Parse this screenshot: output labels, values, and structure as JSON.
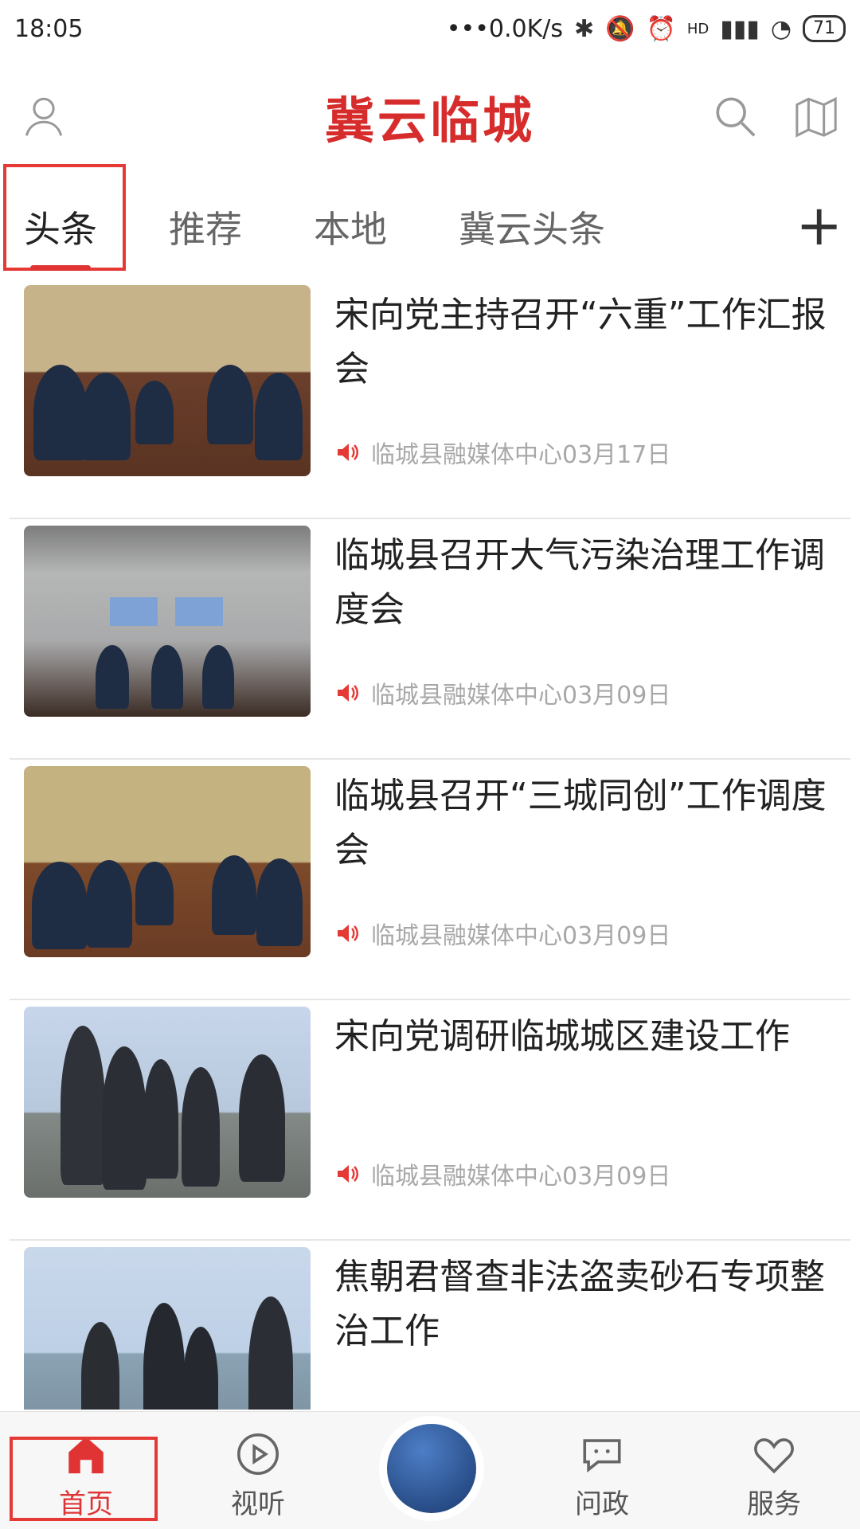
{
  "status_bar": {
    "time": "18:05",
    "network_speed": "•••0.0K/s",
    "signal_label": "HD",
    "battery": "71"
  },
  "header": {
    "title": "冀云临城",
    "left_icon": "user-icon",
    "right_icons": [
      "search-icon",
      "map-icon"
    ]
  },
  "tabs": {
    "items": [
      "头条",
      "推荐",
      "本地",
      "冀云头条"
    ],
    "active_index": 0,
    "add_label": "+"
  },
  "feed": {
    "items": [
      {
        "title": "宋向党主持召开“六重”工作汇报会",
        "source": "临城县融媒体中心03月17日"
      },
      {
        "title": "临城县召开大气污染治理工作调度会",
        "source": "临城县融媒体中心03月09日"
      },
      {
        "title": "临城县召开“三城同创”工作调度会",
        "source": "临城县融媒体中心03月09日"
      },
      {
        "title": "宋向党调研临城城区建设工作",
        "source": "临城县融媒体中心03月09日"
      },
      {
        "title": "焦朝君督查非法盗卖砂石专项整治工作",
        "source": ""
      }
    ]
  },
  "bottom_nav": {
    "items": [
      {
        "label": "首页",
        "icon": "home-icon"
      },
      {
        "label": "视听",
        "icon": "play-icon"
      },
      {
        "label": "",
        "icon": "center-logo"
      },
      {
        "label": "问政",
        "icon": "chat-icon"
      },
      {
        "label": "服务",
        "icon": "heart-icon"
      }
    ],
    "active_index": 0
  },
  "colors": {
    "accent": "#e03434",
    "highlight_box": "#e53935"
  }
}
